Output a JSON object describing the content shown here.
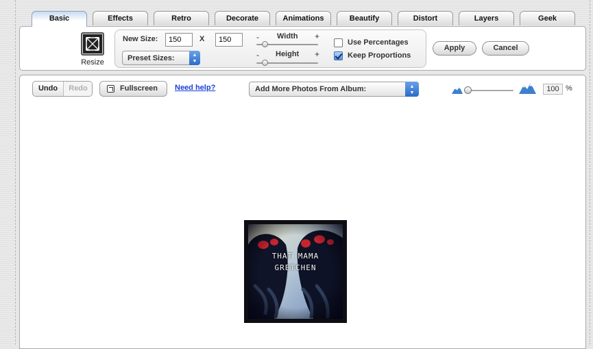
{
  "tabs": [
    "Basic",
    "Effects",
    "Retro",
    "Decorate",
    "Animations",
    "Beautify",
    "Distort",
    "Layers",
    "Geek"
  ],
  "tool": {
    "name": "Resize",
    "new_size_label": "New Size:",
    "width_value": "150",
    "height_value": "150",
    "times": "X",
    "preset_label": "Preset Sizes:",
    "width_label": "Width",
    "height_label": "Height",
    "minus": "-",
    "plus": "+",
    "use_percentages": "Use Percentages",
    "use_percentages_checked": false,
    "keep_proportions": "Keep Proportions",
    "keep_proportions_checked": true,
    "apply": "Apply",
    "cancel": "Cancel"
  },
  "toolbar": {
    "undo": "Undo",
    "redo": "Redo",
    "fullscreen": "Fullscreen",
    "help": "Need help?",
    "album_label": "Add More Photos From Album:",
    "zoom_value": "100",
    "zoom_unit": "%"
  },
  "photo": {
    "line1": "THAT MAMA",
    "line2": "GRETCHEN"
  },
  "colors": {
    "accent": "#2b6bc8",
    "link": "#1a3fd6"
  }
}
